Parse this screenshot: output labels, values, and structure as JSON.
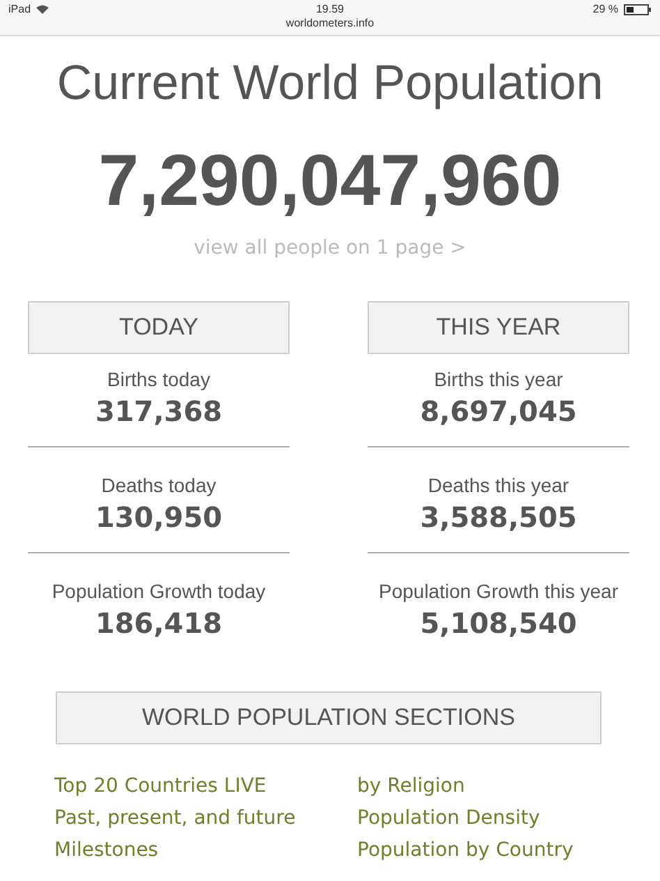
{
  "status_bar": {
    "device": "iPad",
    "time": "19.59",
    "url": "worldometers.info",
    "battery": "29 %"
  },
  "title": "Current World Population",
  "population": "7,290,047,960",
  "view_link": "view all people on 1 page >",
  "columns": [
    {
      "heading": "TODAY",
      "stats": [
        {
          "label": "Births today",
          "value": "317,368"
        },
        {
          "label": "Deaths today",
          "value": "130,950"
        },
        {
          "label": "Population Growth today",
          "value": "186,418"
        }
      ]
    },
    {
      "heading": "THIS YEAR",
      "stats": [
        {
          "label": "Births this year",
          "value": "8,697,045"
        },
        {
          "label": "Deaths this year",
          "value": "3,588,505"
        },
        {
          "label": "Population Growth this year",
          "value": "5,108,540"
        }
      ]
    }
  ],
  "sections": {
    "heading": "WORLD POPULATION SECTIONS",
    "links": [
      [
        "Top 20 Countries LIVE",
        "Past, present, and future",
        "Milestones"
      ],
      [
        "by Religion",
        "Population Density",
        "Population by Country"
      ]
    ]
  }
}
